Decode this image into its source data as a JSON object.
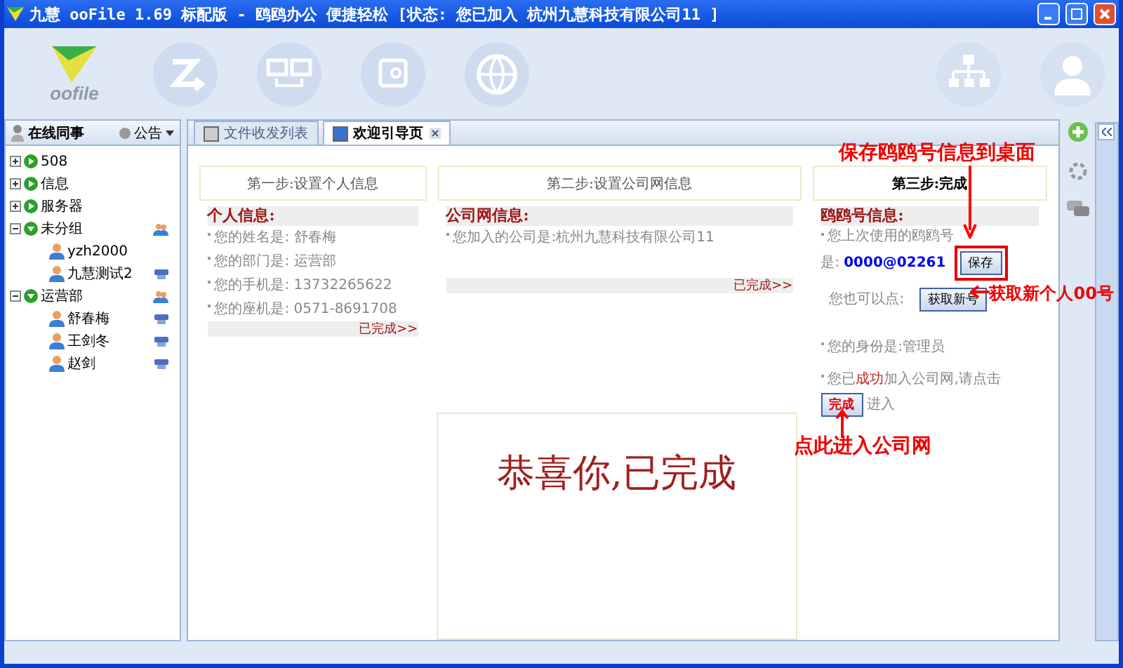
{
  "window": {
    "title": "九慧 ooFile 1.69 标配版 - 鸥鸥办公 便捷轻松 [状态: 您已加入 杭州九慧科技有限公司11 ]"
  },
  "logo": {
    "text": "oofile"
  },
  "sidebar": {
    "title": "在线同事",
    "notice_menu": "公告",
    "tree": [
      {
        "kind": "group",
        "label": "508",
        "expanded": false
      },
      {
        "kind": "group",
        "label": "信息",
        "expanded": false
      },
      {
        "kind": "group",
        "label": "服务器",
        "expanded": false
      },
      {
        "kind": "group",
        "label": "未分组",
        "expanded": true,
        "children": [
          {
            "kind": "user",
            "label": "yzh2000",
            "device": false
          },
          {
            "kind": "user",
            "label": "九慧测试2",
            "device": true
          }
        ]
      },
      {
        "kind": "group",
        "label": "运营部",
        "expanded": true,
        "children": [
          {
            "kind": "user",
            "label": "舒春梅",
            "device": true
          },
          {
            "kind": "user",
            "label": "王剑冬",
            "device": true
          },
          {
            "kind": "user",
            "label": "赵剑",
            "device": true
          }
        ]
      }
    ]
  },
  "tabs": [
    {
      "label": "文件收发列表",
      "selected": false,
      "closable": false
    },
    {
      "label": "欢迎引导页",
      "selected": true,
      "closable": true
    }
  ],
  "steps": [
    {
      "title": "第一步:设置个人信息",
      "selected": false
    },
    {
      "title": "第二步:设置公司网信息",
      "selected": false
    },
    {
      "title": "第三步:完成",
      "selected": true
    }
  ],
  "personal": {
    "heading": "个人信息:",
    "lines": [
      "您的姓名是: 舒春梅",
      "您的部门是: 运营部",
      "您的手机是: 13732265622",
      "您的座机是: 0571-8691708"
    ],
    "done_link": "已完成>>"
  },
  "company": {
    "heading": "公司网信息:",
    "lines": [
      "您加入的公司是:杭州九慧科技有限公司11"
    ],
    "done_link": "已完成>>"
  },
  "account": {
    "heading": "鸥鸥号信息:",
    "last_used_label": "您上次使用的鸥鸥号",
    "last_used_prefix": "是:",
    "number": "0000@02261",
    "save_button": "保存",
    "alt_label": "您也可以点:",
    "new_button": "获取新号",
    "role_line": "您的身份是:管理员",
    "joined_before": "您已",
    "joined_highlight": "成功",
    "joined_after": "加入公司网,请点击",
    "finish_button": "完成",
    "enter_text": "进入"
  },
  "congrats": "恭喜你,已完成",
  "annotations": [
    {
      "text": "保存鸥鸥号信息到桌面"
    },
    {
      "text": "获取新个人00号"
    },
    {
      "text": "点此进入公司网"
    }
  ]
}
